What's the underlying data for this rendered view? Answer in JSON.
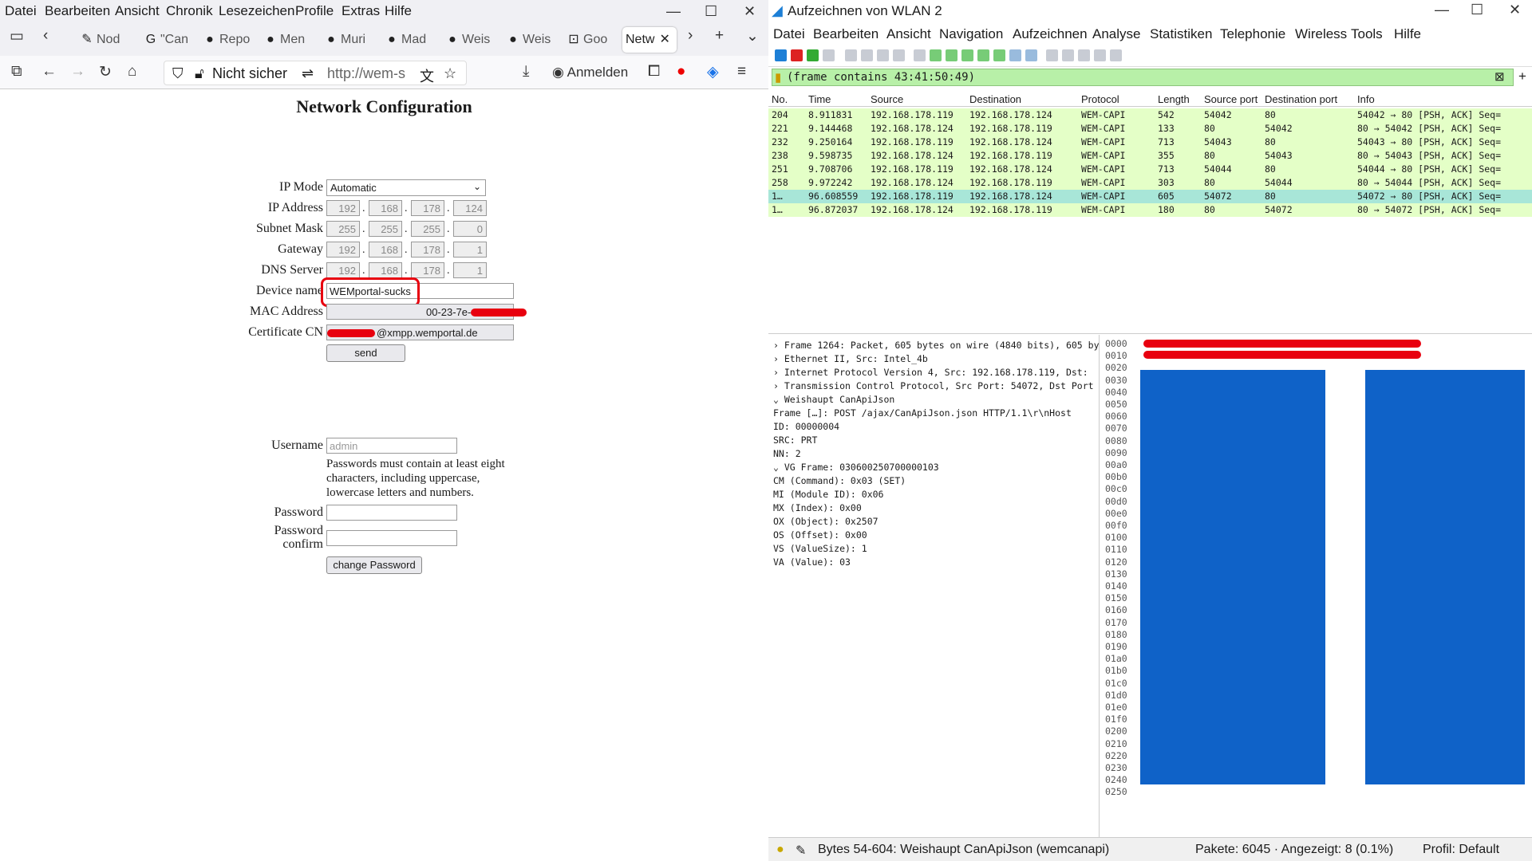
{
  "firefox": {
    "menu": [
      "Datei",
      "Bearbeiten",
      "Ansicht",
      "Chronik",
      "Lesezeichen",
      "Profile",
      "Extras",
      "Hilfe"
    ],
    "tabs": [
      "Nod",
      "\"Can",
      "Repo",
      "Men",
      "Muri",
      "Mad",
      "Weis",
      "Weis",
      "Goo",
      "Netw"
    ],
    "nav": {
      "security": "Nicht sicher",
      "url": "http://wem-s",
      "signin": "Anmelden"
    }
  },
  "page": {
    "title": "Network Configuration",
    "ip_mode": {
      "label": "IP Mode",
      "value": "Automatic"
    },
    "ip_address": {
      "label": "IP Address",
      "octets": [
        "192",
        "168",
        "178",
        "124"
      ]
    },
    "subnet": {
      "label": "Subnet Mask",
      "octets": [
        "255",
        "255",
        "255",
        "0"
      ]
    },
    "gateway": {
      "label": "Gateway",
      "octets": [
        "192",
        "168",
        "178",
        "1"
      ]
    },
    "dns": {
      "label": "DNS Server",
      "octets": [
        "192",
        "168",
        "178",
        "1"
      ]
    },
    "device_name": {
      "label": "Device name",
      "value": "WEMportal-sucks"
    },
    "mac": {
      "label": "MAC Address",
      "value": "00-23-7e-"
    },
    "cert": {
      "label": "Certificate CN",
      "value": "@xmpp.wemportal.de"
    },
    "send": "send",
    "username": {
      "label": "Username",
      "placeholder": "admin"
    },
    "hint": [
      "Passwords must contain at least eight",
      "characters, including uppercase,",
      "lowercase letters and numbers."
    ],
    "password": "Password",
    "password_confirm": [
      "Password",
      "confirm"
    ],
    "change": "change Password"
  },
  "ws": {
    "title": "Aufzeichnen von WLAN 2",
    "menu": [
      "Datei",
      "Bearbeiten",
      "Ansicht",
      "Navigation",
      "Aufzeichnen",
      "Analyse",
      "Statistiken",
      "Telephonie",
      "Wireless",
      "Tools",
      "Hilfe"
    ],
    "filter": "(frame contains 43:41:50:49)",
    "columns": [
      "No.",
      "Time",
      "Source",
      "Destination",
      "Protocol",
      "Length",
      "Source port",
      "Destination port",
      "Info"
    ],
    "rows": [
      [
        "204",
        "8.911831",
        "192.168.178.119",
        "192.168.178.124",
        "WEM-CAPI",
        "542",
        "54042",
        "80",
        "54042 → 80 [PSH, ACK] Seq="
      ],
      [
        "221",
        "9.144468",
        "192.168.178.124",
        "192.168.178.119",
        "WEM-CAPI",
        "133",
        "80",
        "54042",
        "80 → 54042 [PSH, ACK] Seq="
      ],
      [
        "232",
        "9.250164",
        "192.168.178.119",
        "192.168.178.124",
        "WEM-CAPI",
        "713",
        "54043",
        "80",
        "54043 → 80 [PSH, ACK] Seq="
      ],
      [
        "238",
        "9.598735",
        "192.168.178.124",
        "192.168.178.119",
        "WEM-CAPI",
        "355",
        "80",
        "54043",
        "80 → 54043 [PSH, ACK] Seq="
      ],
      [
        "251",
        "9.708706",
        "192.168.178.119",
        "192.168.178.124",
        "WEM-CAPI",
        "713",
        "54044",
        "80",
        "54044 → 80 [PSH, ACK] Seq="
      ],
      [
        "258",
        "9.972242",
        "192.168.178.124",
        "192.168.178.119",
        "WEM-CAPI",
        "303",
        "80",
        "54044",
        "80 → 54044 [PSH, ACK] Seq="
      ],
      [
        "1…",
        "96.608559",
        "192.168.178.119",
        "192.168.178.124",
        "WEM-CAPI",
        "605",
        "54072",
        "80",
        "54072 → 80 [PSH, ACK] Seq="
      ],
      [
        "1…",
        "96.872037",
        "192.168.178.124",
        "192.168.178.119",
        "WEM-CAPI",
        "180",
        "80",
        "54072",
        "80 → 54072 [PSH, ACK] Seq="
      ]
    ],
    "tree": [
      "›  Frame 1264: Packet, 605 bytes on wire (4840 bits), 605 by",
      "›  Ethernet II, Src: Intel_4b",
      "›  Internet Protocol Version 4, Src: 192.168.178.119, Dst:",
      "›  Transmission Control Protocol, Src Port: 54072, Dst Port",
      "⌄  Weishaupt CanApiJson",
      "      Frame […]: POST /ajax/CanApiJson.json HTTP/1.1\\r\\nHost",
      "      ID: 00000004",
      "      SRC: PRT",
      "      NN: 2",
      "   ⌄  VG Frame: 030600250700000103",
      "         CM (Command): 0x03 (SET)",
      "         MI (Module ID): 0x06",
      "         MX (Index): 0x00",
      "         OX (Object): 0x2507",
      "         OS (Offset): 0x00",
      "         VS (ValueSize): 1",
      "         VA (Value): 03"
    ],
    "hex_offsets": [
      "0000",
      "0010",
      "0020",
      "0030",
      "0040",
      "0050",
      "0060",
      "0070",
      "0080",
      "0090",
      "00a0",
      "00b0",
      "00c0",
      "00d0",
      "00e0",
      "00f0",
      "0100",
      "0110",
      "0120",
      "0130",
      "0140",
      "0150",
      "0160",
      "0170",
      "0180",
      "0190",
      "01a0",
      "01b0",
      "01c0",
      "01d0",
      "01e0",
      "01f0",
      "0200",
      "0210",
      "0220",
      "0230",
      "0240",
      "0250"
    ],
    "status": {
      "bytes": "Bytes 54-604: Weishaupt CanApiJson (wemcanapi)",
      "packets": "Pakete: 6045 · Angezeigt: 8 (0.1%)",
      "profile": "Profil: Default"
    }
  }
}
